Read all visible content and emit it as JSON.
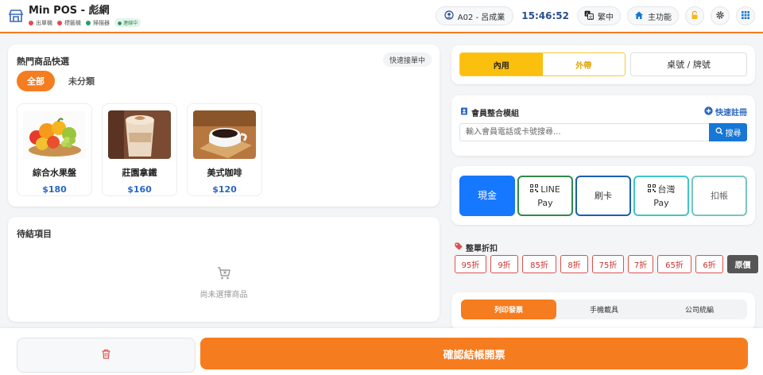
{
  "header": {
    "title": "Min POS - 彪網",
    "devices": [
      {
        "label": "出單機",
        "color": "#e5484d"
      },
      {
        "label": "標籤機",
        "color": "#e5484d"
      },
      {
        "label": "掃描器",
        "color": "#22a06b"
      }
    ],
    "connection_badge": "● 連線中",
    "user": "A02 - 呂成業",
    "time": "15:46:52",
    "language": "繁中",
    "main_menu": "主功能",
    "icons": [
      "store-icon",
      "user-circle-icon",
      "translate-icon",
      "home-icon",
      "lock-icon",
      "gear-icon",
      "grid-icon"
    ]
  },
  "hot_products": {
    "title": "熱門商品快選",
    "quick_badge": "快速接單中",
    "categories": [
      {
        "label": "全部",
        "active": true
      },
      {
        "label": "未分類",
        "active": false
      }
    ],
    "items": [
      {
        "name": "綜合水果盤",
        "price": "$180"
      },
      {
        "name": "莊園拿鐵",
        "price": "$160"
      },
      {
        "name": "美式咖啡",
        "price": "$120"
      }
    ]
  },
  "pending": {
    "title": "待結項目",
    "empty_text": "尚未選擇商品"
  },
  "order_type": {
    "dine_in": "內用",
    "takeout": "外帶",
    "table": "桌號 / 牌號",
    "selected": "內用"
  },
  "member": {
    "title": "會員整合模組",
    "register": "快速註冊",
    "placeholder": "輸入會員電話或卡號搜尋...",
    "search": "搜尋"
  },
  "payment": {
    "cash": "現金",
    "line_pay_line1": "LINE",
    "line_pay_line2": "Pay",
    "card": "刷卡",
    "taiwan_pay_line1": "台灣",
    "taiwan_pay_line2": "Pay",
    "account": "扣帳",
    "selected": "現金"
  },
  "discount": {
    "title": "整單折扣",
    "options": [
      "95折",
      "9折",
      "85折",
      "8折",
      "75折",
      "7折",
      "65折",
      "6折"
    ],
    "original": "原價"
  },
  "invoice": {
    "tabs": [
      {
        "label": "列印發票",
        "active": true
      },
      {
        "label": "手機載具",
        "active": false
      },
      {
        "label": "公司統編",
        "active": false
      }
    ]
  },
  "footer": {
    "confirm": "確認結帳開票"
  },
  "colors": {
    "accent": "#f57c1f",
    "primary_blue": "#1677ff",
    "takeout_yellow": "#fbbf0d",
    "discount_red": "#c9302c"
  }
}
